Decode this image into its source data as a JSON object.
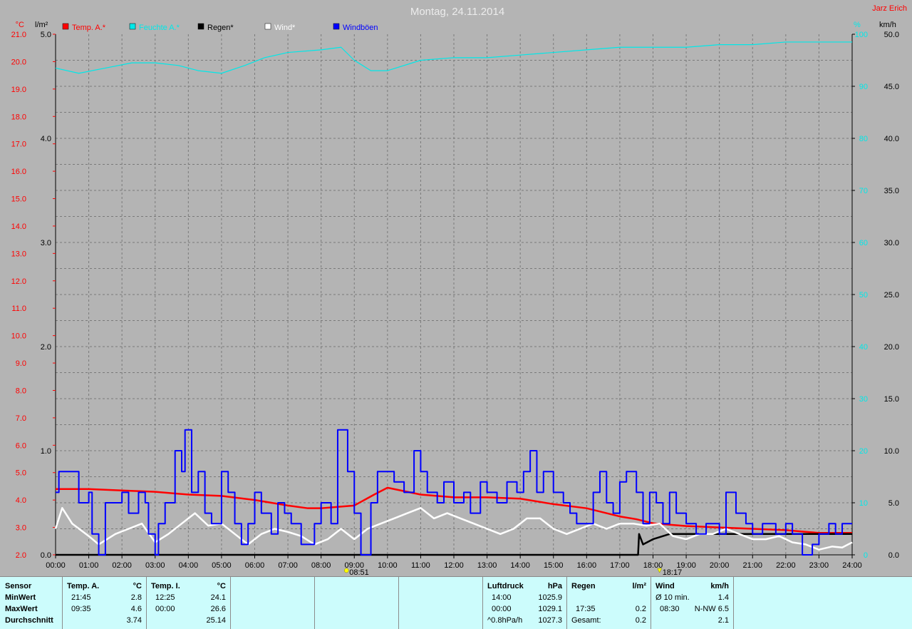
{
  "title": "Montag, 24.11.2014",
  "station": "Jarz Erich",
  "axes": {
    "left_temp_unit": "°C",
    "left_rain_unit": "l/m²",
    "right_hum_unit": "%",
    "right_wind_unit": "km/h",
    "temp_ticks": [
      "21.0",
      "20.0",
      "19.0",
      "18.0",
      "17.0",
      "16.0",
      "15.0",
      "14.0",
      "13.0",
      "12.0",
      "11.0",
      "10.0",
      "9.0",
      "8.0",
      "7.0",
      "6.0",
      "5.0",
      "4.0",
      "3.0",
      "2.0"
    ],
    "rain_ticks": [
      "5.0",
      "4.0",
      "3.0",
      "2.0",
      "1.0",
      "0.0"
    ],
    "hum_ticks": [
      "100",
      "90",
      "80",
      "70",
      "60",
      "50",
      "40",
      "30",
      "20",
      "10",
      "0"
    ],
    "wind_ticks": [
      "50.0",
      "45.0",
      "40.0",
      "35.0",
      "30.0",
      "25.0",
      "20.0",
      "15.0",
      "10.0",
      "5.0",
      "0.0"
    ],
    "x_ticks": [
      "00:00",
      "01:00",
      "02:00",
      "03:00",
      "04:00",
      "05:00",
      "06:00",
      "07:00",
      "08:00",
      "09:00",
      "10:00",
      "11:00",
      "12:00",
      "13:00",
      "14:00",
      "15:00",
      "16:00",
      "17:00",
      "18:00",
      "19:00",
      "20:00",
      "21:00",
      "22:00",
      "23:00",
      "24:00"
    ]
  },
  "markers": {
    "sunrise": "08:51",
    "sunset": "18:17"
  },
  "colors": {
    "background": "#b4b4b4",
    "temp": "#ff0000",
    "humidity": "#00e8e8",
    "rain": "#000000",
    "wind": "#ffffff",
    "gusts": "#0000ff",
    "grid": "#7a7a7a",
    "panel": "#ccfcfc"
  },
  "chart_data": {
    "type": "line",
    "title": "Montag, 24.11.2014",
    "x_unit": "hours",
    "xlim": [
      0,
      24
    ],
    "y_ranges": {
      "temp": [
        2.0,
        21.0
      ],
      "rain": [
        0.0,
        5.0
      ],
      "humidity": [
        0,
        100
      ],
      "wind": [
        0.0,
        50.0
      ]
    },
    "grid": true,
    "legend_position": "top",
    "series": [
      {
        "name": "Temp. A.*",
        "axis": "temp",
        "color": "#ff0000",
        "x": [
          0,
          1,
          2,
          3,
          4,
          5,
          6,
          7,
          7.6,
          8,
          8.5,
          9,
          9.6,
          10,
          11,
          12,
          13,
          14,
          15,
          16,
          17,
          17.5,
          18,
          18.5,
          19,
          20,
          21,
          22,
          22.5,
          23,
          24
        ],
        "y": [
          4.4,
          4.4,
          4.35,
          4.3,
          4.2,
          4.15,
          4.0,
          3.8,
          3.7,
          3.7,
          3.75,
          3.8,
          4.2,
          4.45,
          4.2,
          4.1,
          4.1,
          4.05,
          3.85,
          3.7,
          3.4,
          3.3,
          3.15,
          3.1,
          3.05,
          3.0,
          2.95,
          2.9,
          2.85,
          2.8,
          2.8
        ]
      },
      {
        "name": "Feuchte A.*",
        "axis": "humidity",
        "color": "#00e8e8",
        "x": [
          0,
          0.7,
          1.5,
          2.3,
          3,
          3.7,
          4.3,
          5,
          5.7,
          6.3,
          7,
          8,
          8.6,
          9,
          9.5,
          10,
          11,
          12,
          13,
          14,
          15,
          16,
          17,
          18,
          19,
          20,
          21,
          22,
          23,
          24
        ],
        "y": [
          93.5,
          92.5,
          93.5,
          94.5,
          94.5,
          94,
          93,
          92.5,
          94,
          95.5,
          96.5,
          97,
          97.5,
          95,
          93,
          93,
          95,
          95.5,
          95.5,
          96,
          96.5,
          97,
          97.5,
          97.5,
          97.5,
          98,
          98,
          98.5,
          98.5,
          98.5
        ]
      },
      {
        "name": "Regen*",
        "axis": "rain",
        "color": "#000000",
        "x": [
          0,
          17.55,
          17.58,
          17.7,
          18,
          18.5,
          19,
          24
        ],
        "y": [
          0,
          0,
          0.2,
          0.1,
          0.15,
          0.2,
          0.2,
          0.2
        ]
      },
      {
        "name": "Wind*",
        "axis": "wind",
        "color": "#ffffff",
        "x": [
          0,
          0.2,
          0.5,
          1.0,
          1.3,
          1.8,
          2.2,
          2.6,
          3.0,
          3.4,
          3.8,
          4.2,
          4.6,
          5.0,
          5.4,
          5.8,
          6.2,
          6.6,
          7.0,
          7.4,
          7.8,
          8.2,
          8.6,
          9.0,
          9.4,
          9.8,
          10.2,
          10.6,
          11.0,
          11.4,
          11.8,
          12.2,
          12.6,
          13.0,
          13.4,
          13.8,
          14.2,
          14.6,
          15.0,
          15.4,
          15.8,
          16.2,
          16.6,
          17.0,
          17.4,
          17.8,
          18.2,
          18.6,
          19.0,
          19.4,
          19.8,
          20.2,
          20.6,
          21.0,
          21.4,
          21.8,
          22.2,
          22.6,
          23.0,
          23.4,
          23.7,
          24
        ],
        "y": [
          2.5,
          4.5,
          3.0,
          1.8,
          1.0,
          2.0,
          2.5,
          3.0,
          1.2,
          2.0,
          3.0,
          4.0,
          2.8,
          3.0,
          2.0,
          1.0,
          2.0,
          2.5,
          2.2,
          1.8,
          1.0,
          1.5,
          2.5,
          1.5,
          2.5,
          3.0,
          3.5,
          4.0,
          4.5,
          3.5,
          4.0,
          3.5,
          3.0,
          2.5,
          2.0,
          2.5,
          3.5,
          3.5,
          2.5,
          2.0,
          2.5,
          3.0,
          2.5,
          3.0,
          3.0,
          2.8,
          3.0,
          1.8,
          1.5,
          2.0,
          2.0,
          2.5,
          2.0,
          1.5,
          1.5,
          1.8,
          1.2,
          1.0,
          0.5,
          0.8,
          0.7,
          1.2
        ]
      },
      {
        "name": "Windböen",
        "axis": "wind",
        "color": "#0000ff",
        "x": [
          0,
          0.1,
          0.4,
          0.7,
          1.0,
          1.1,
          1.3,
          1.5,
          1.8,
          2.0,
          2.2,
          2.5,
          2.7,
          2.8,
          3.0,
          3.1,
          3.3,
          3.6,
          3.8,
          3.9,
          4.1,
          4.3,
          4.5,
          4.7,
          5.0,
          5.2,
          5.4,
          5.6,
          5.8,
          6.0,
          6.2,
          6.5,
          6.7,
          6.9,
          7.1,
          7.4,
          7.6,
          7.8,
          8.0,
          8.3,
          8.5,
          8.6,
          8.8,
          9.0,
          9.2,
          9.5,
          9.7,
          9.9,
          10.2,
          10.5,
          10.8,
          11.0,
          11.2,
          11.5,
          11.7,
          12.0,
          12.3,
          12.5,
          12.8,
          13.0,
          13.3,
          13.6,
          13.9,
          14.1,
          14.3,
          14.5,
          14.7,
          15.0,
          15.3,
          15.5,
          15.7,
          16.0,
          16.2,
          16.4,
          16.6,
          16.8,
          17.0,
          17.2,
          17.5,
          17.7,
          17.9,
          18.1,
          18.3,
          18.5,
          18.7,
          19.0,
          19.3,
          19.6,
          20.0,
          20.2,
          20.5,
          20.8,
          21.0,
          21.3,
          21.7,
          22.0,
          22.2,
          22.5,
          22.8,
          23.0,
          23.3,
          23.5,
          23.7,
          24
        ],
        "y": [
          6.0,
          8.0,
          8.0,
          5.0,
          6.0,
          2.0,
          0.0,
          5.0,
          5.0,
          6.0,
          4.0,
          6.0,
          5.0,
          2.0,
          0.0,
          3.0,
          5.0,
          10.0,
          8.0,
          12.0,
          6.0,
          8.0,
          4.0,
          3.0,
          8.0,
          6.0,
          3.0,
          1.0,
          3.0,
          6.0,
          4.0,
          2.0,
          5.0,
          4.0,
          3.0,
          1.0,
          1.0,
          3.0,
          5.0,
          3.0,
          12.0,
          12.0,
          8.0,
          4.0,
          0.0,
          5.0,
          8.0,
          8.0,
          7.0,
          6.0,
          10.0,
          8.0,
          6.0,
          5.0,
          7.0,
          5.0,
          6.0,
          4.0,
          7.0,
          6.0,
          5.0,
          7.0,
          6.0,
          8.0,
          10.0,
          6.0,
          8.0,
          6.0,
          5.0,
          4.0,
          3.0,
          3.0,
          6.0,
          8.0,
          5.0,
          4.0,
          7.0,
          8.0,
          6.0,
          3.0,
          6.0,
          5.0,
          3.0,
          6.0,
          4.0,
          3.0,
          2.0,
          3.0,
          2.0,
          6.0,
          4.0,
          3.0,
          2.0,
          3.0,
          2.0,
          3.0,
          2.0,
          0.0,
          1.0,
          2.0,
          3.0,
          2.0,
          3.0,
          3.0
        ]
      }
    ]
  },
  "panel": {
    "sensor": {
      "header": "Sensor",
      "min": "MinWert",
      "max": "MaxWert",
      "avg": "Durchschnitt"
    },
    "temp_a": {
      "header": "Temp. A.",
      "unit": "°C",
      "min_time": "21:45",
      "min_val": "2.8",
      "max_time": "09:35",
      "max_val": "4.6",
      "avg_val": "3.74"
    },
    "temp_i": {
      "header": "Temp. I.",
      "unit": "°C",
      "min_time": "12:25",
      "min_val": "24.1",
      "max_time": "00:00",
      "max_val": "26.6",
      "avg_val": "25.14"
    },
    "pressure": {
      "header": "Luftdruck",
      "unit": "hPa",
      "min_time": "14:00",
      "min_val": "1025.9",
      "max_time": "00:00",
      "max_val": "1029.1",
      "trend_label": "^0.8hPa/h",
      "trend_val": "1027.3"
    },
    "rain": {
      "header": "Regen",
      "unit": "l/m²",
      "time": "17:35",
      "val": "0.2",
      "total_label": "Gesamt:",
      "total_val": "0.2"
    },
    "wind": {
      "header": "Wind",
      "unit": "km/h",
      "avg_label": "Ø 10 min.",
      "avg_val": "1.4",
      "max_time": "08:30",
      "max_val": "N-NW 6.5",
      "mean_val": "2.1"
    }
  }
}
